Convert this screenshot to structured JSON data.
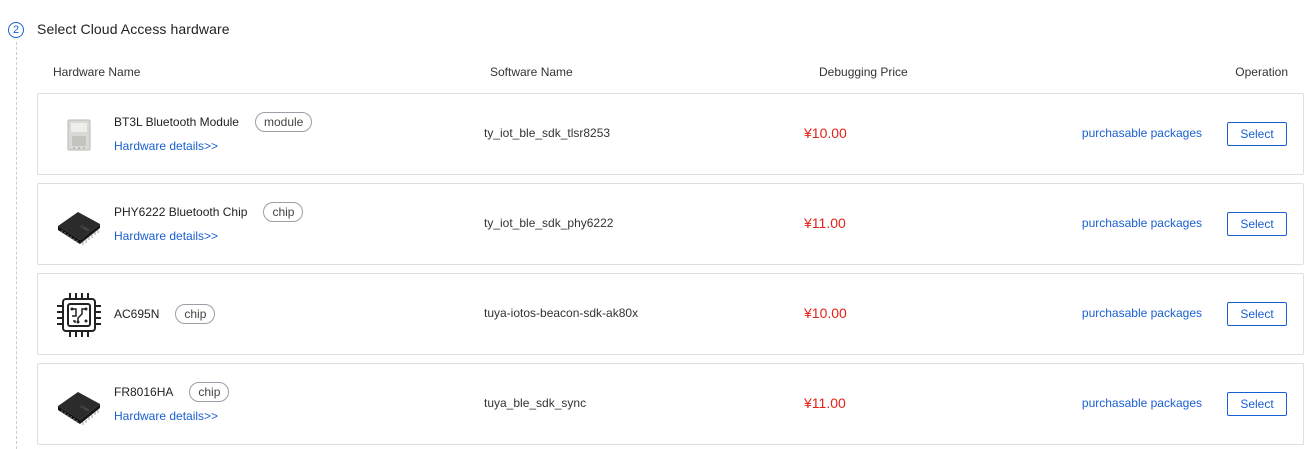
{
  "section": {
    "step_number": "2",
    "title": "Select Cloud Access hardware"
  },
  "table": {
    "headers": {
      "hardware_name": "Hardware Name",
      "software_name": "Software Name",
      "debugging_price": "Debugging Price",
      "operation": "Operation"
    },
    "rows": [
      {
        "image_icon": "module-board-icon",
        "name": "BT3L Bluetooth Module",
        "tag": "module",
        "details_link": "Hardware details>>",
        "software": "ty_iot_ble_sdk_tlsr8253",
        "price": "¥10.00",
        "packages_link": "purchasable packages",
        "select_label": "Select"
      },
      {
        "image_icon": "chip-package-icon",
        "name": "PHY6222 Bluetooth Chip",
        "tag": "chip",
        "details_link": "Hardware details>>",
        "software": "ty_iot_ble_sdk_phy6222",
        "price": "¥11.00",
        "packages_link": "purchasable packages",
        "select_label": "Select"
      },
      {
        "image_icon": "circuit-chip-icon",
        "name": "AC695N",
        "tag": "chip",
        "details_link": "",
        "software": "tuya-iotos-beacon-sdk-ak80x",
        "price": "¥10.00",
        "packages_link": "purchasable packages",
        "select_label": "Select"
      },
      {
        "image_icon": "chip-package-icon",
        "name": "FR8016HA",
        "tag": "chip",
        "details_link": "Hardware details>>",
        "software": "tuya_ble_sdk_sync",
        "price": "¥11.00",
        "packages_link": "purchasable packages",
        "select_label": "Select"
      }
    ]
  },
  "colors": {
    "accent": "#1a5fd1",
    "price": "#e2231a",
    "border": "#dcdfe6"
  }
}
